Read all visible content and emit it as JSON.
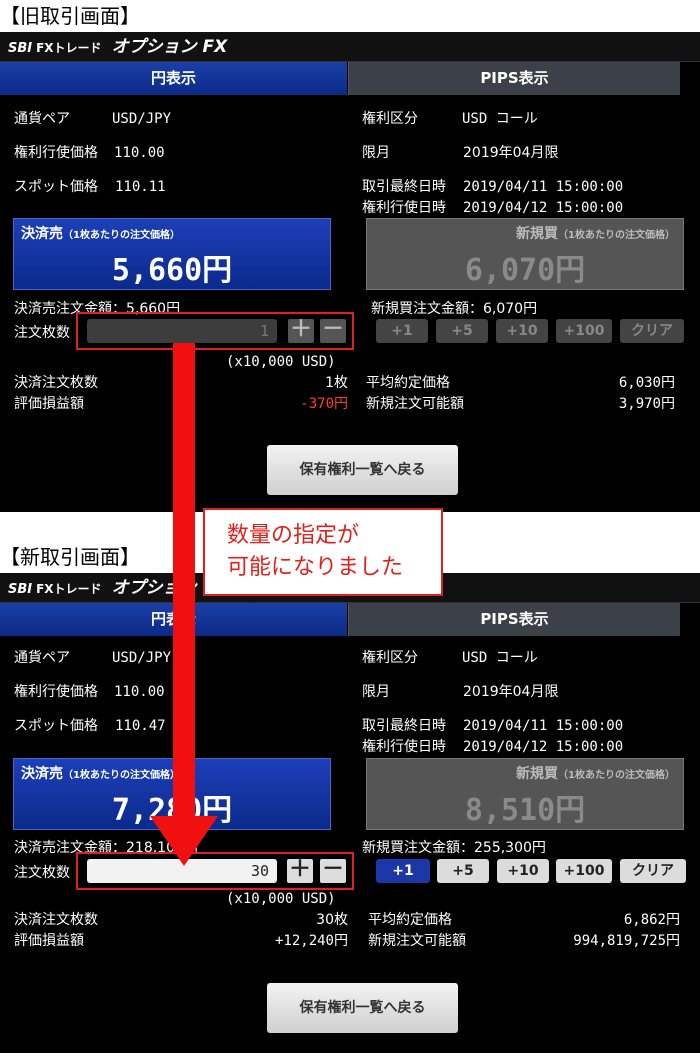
{
  "old": {
    "section_label": "【旧取引画面】",
    "brand": {
      "sbi": "SBI",
      "fx_trade": "FXトレード",
      "option": "オプション FX"
    },
    "tabs": {
      "yen": "円表示",
      "pips": "PIPS表示"
    },
    "info": {
      "pair_label": "通貨ペア",
      "pair_value": "USD/JPY",
      "strike_label": "権利行使価格",
      "strike_value": "110.00",
      "spot_label": "スポット価格",
      "spot_value": "110.11",
      "right_type_label": "権利区分",
      "right_type_value": "USD コール",
      "expiry_month_label": "限月",
      "expiry_month_value": "2019年04月限",
      "last_trade_label": "取引最終日時",
      "last_trade_value": "2019/04/11 15:00:00",
      "exercise_label": "権利行使日時",
      "exercise_value": "2019/04/12 15:00:00"
    },
    "sell_box": {
      "title": "決済売",
      "note": "（1枚あたりの注文価格）",
      "price": "5,660円"
    },
    "buy_box": {
      "title": "新規買",
      "note": "（1枚あたりの注文価格）",
      "price": "6,070円"
    },
    "sell_amount": "決済売注文金額：5,660円",
    "buy_amount": "新規買注文金額：6,070円",
    "qty_label": "注文枚数",
    "qty_value": "1",
    "plus": "＋",
    "minus": "－",
    "inc": [
      "+1",
      "+5",
      "+10",
      "+100",
      "クリア"
    ],
    "unit": "(x10,000 USD)",
    "stats": {
      "settle_qty_label": "決済注文枚数",
      "settle_qty_value": "1枚",
      "pnl_label": "評価損益額",
      "pnl_value": "-370円",
      "avg_label": "平均約定価格",
      "avg_value": "6,030円",
      "avail_label": "新規注文可能額",
      "avail_value": "3,970円"
    },
    "back_button": "保有権利一覧へ戻る"
  },
  "new": {
    "section_label": "【新取引画面】",
    "brand": {
      "sbi": "SBI",
      "fx_trade": "FXトレード",
      "option": "オプション FX"
    },
    "tabs": {
      "yen": "円表示",
      "pips": "PIPS表示"
    },
    "info": {
      "pair_label": "通貨ペア",
      "pair_value": "USD/JPY",
      "strike_label": "権利行使価格",
      "strike_value": "110.00",
      "spot_label": "スポット価格",
      "spot_value": "110.47",
      "right_type_label": "権利区分",
      "right_type_value": "USD コール",
      "expiry_month_label": "限月",
      "expiry_month_value": "2019年04月限",
      "last_trade_label": "取引最終日時",
      "last_trade_value": "2019/04/11 15:00:00",
      "exercise_label": "権利行使日時",
      "exercise_value": "2019/04/12 15:00:00"
    },
    "sell_box": {
      "title": "決済売",
      "note": "（1枚あたりの注文価格）",
      "price": "7,280円"
    },
    "buy_box": {
      "title": "新規買",
      "note": "（1枚あたりの注文価格）",
      "price": "8,510円"
    },
    "sell_amount": "決済売注文金額：218,100円",
    "buy_amount": "新規買注文金額：255,300円",
    "qty_label": "注文枚数",
    "qty_value": "30",
    "plus": "＋",
    "minus": "－",
    "inc": [
      "+1",
      "+5",
      "+10",
      "+100",
      "クリア"
    ],
    "unit": "(x10,000 USD)",
    "stats": {
      "settle_qty_label": "決済注文枚数",
      "settle_qty_value": "30枚",
      "pnl_label": "評価損益額",
      "pnl_value": "+12,240円",
      "avg_label": "平均約定価格",
      "avg_value": "6,862円",
      "avail_label": "新規注文可能額",
      "avail_value": "994,819,725円"
    },
    "back_button": "保有権利一覧へ戻る"
  },
  "callout": {
    "line1": "数量の指定が",
    "line2": "可能になりました"
  },
  "colors": {
    "accent_blue": "#1c37a8",
    "loss_red": "#ff3b30",
    "annotation_red": "#e0211b"
  }
}
